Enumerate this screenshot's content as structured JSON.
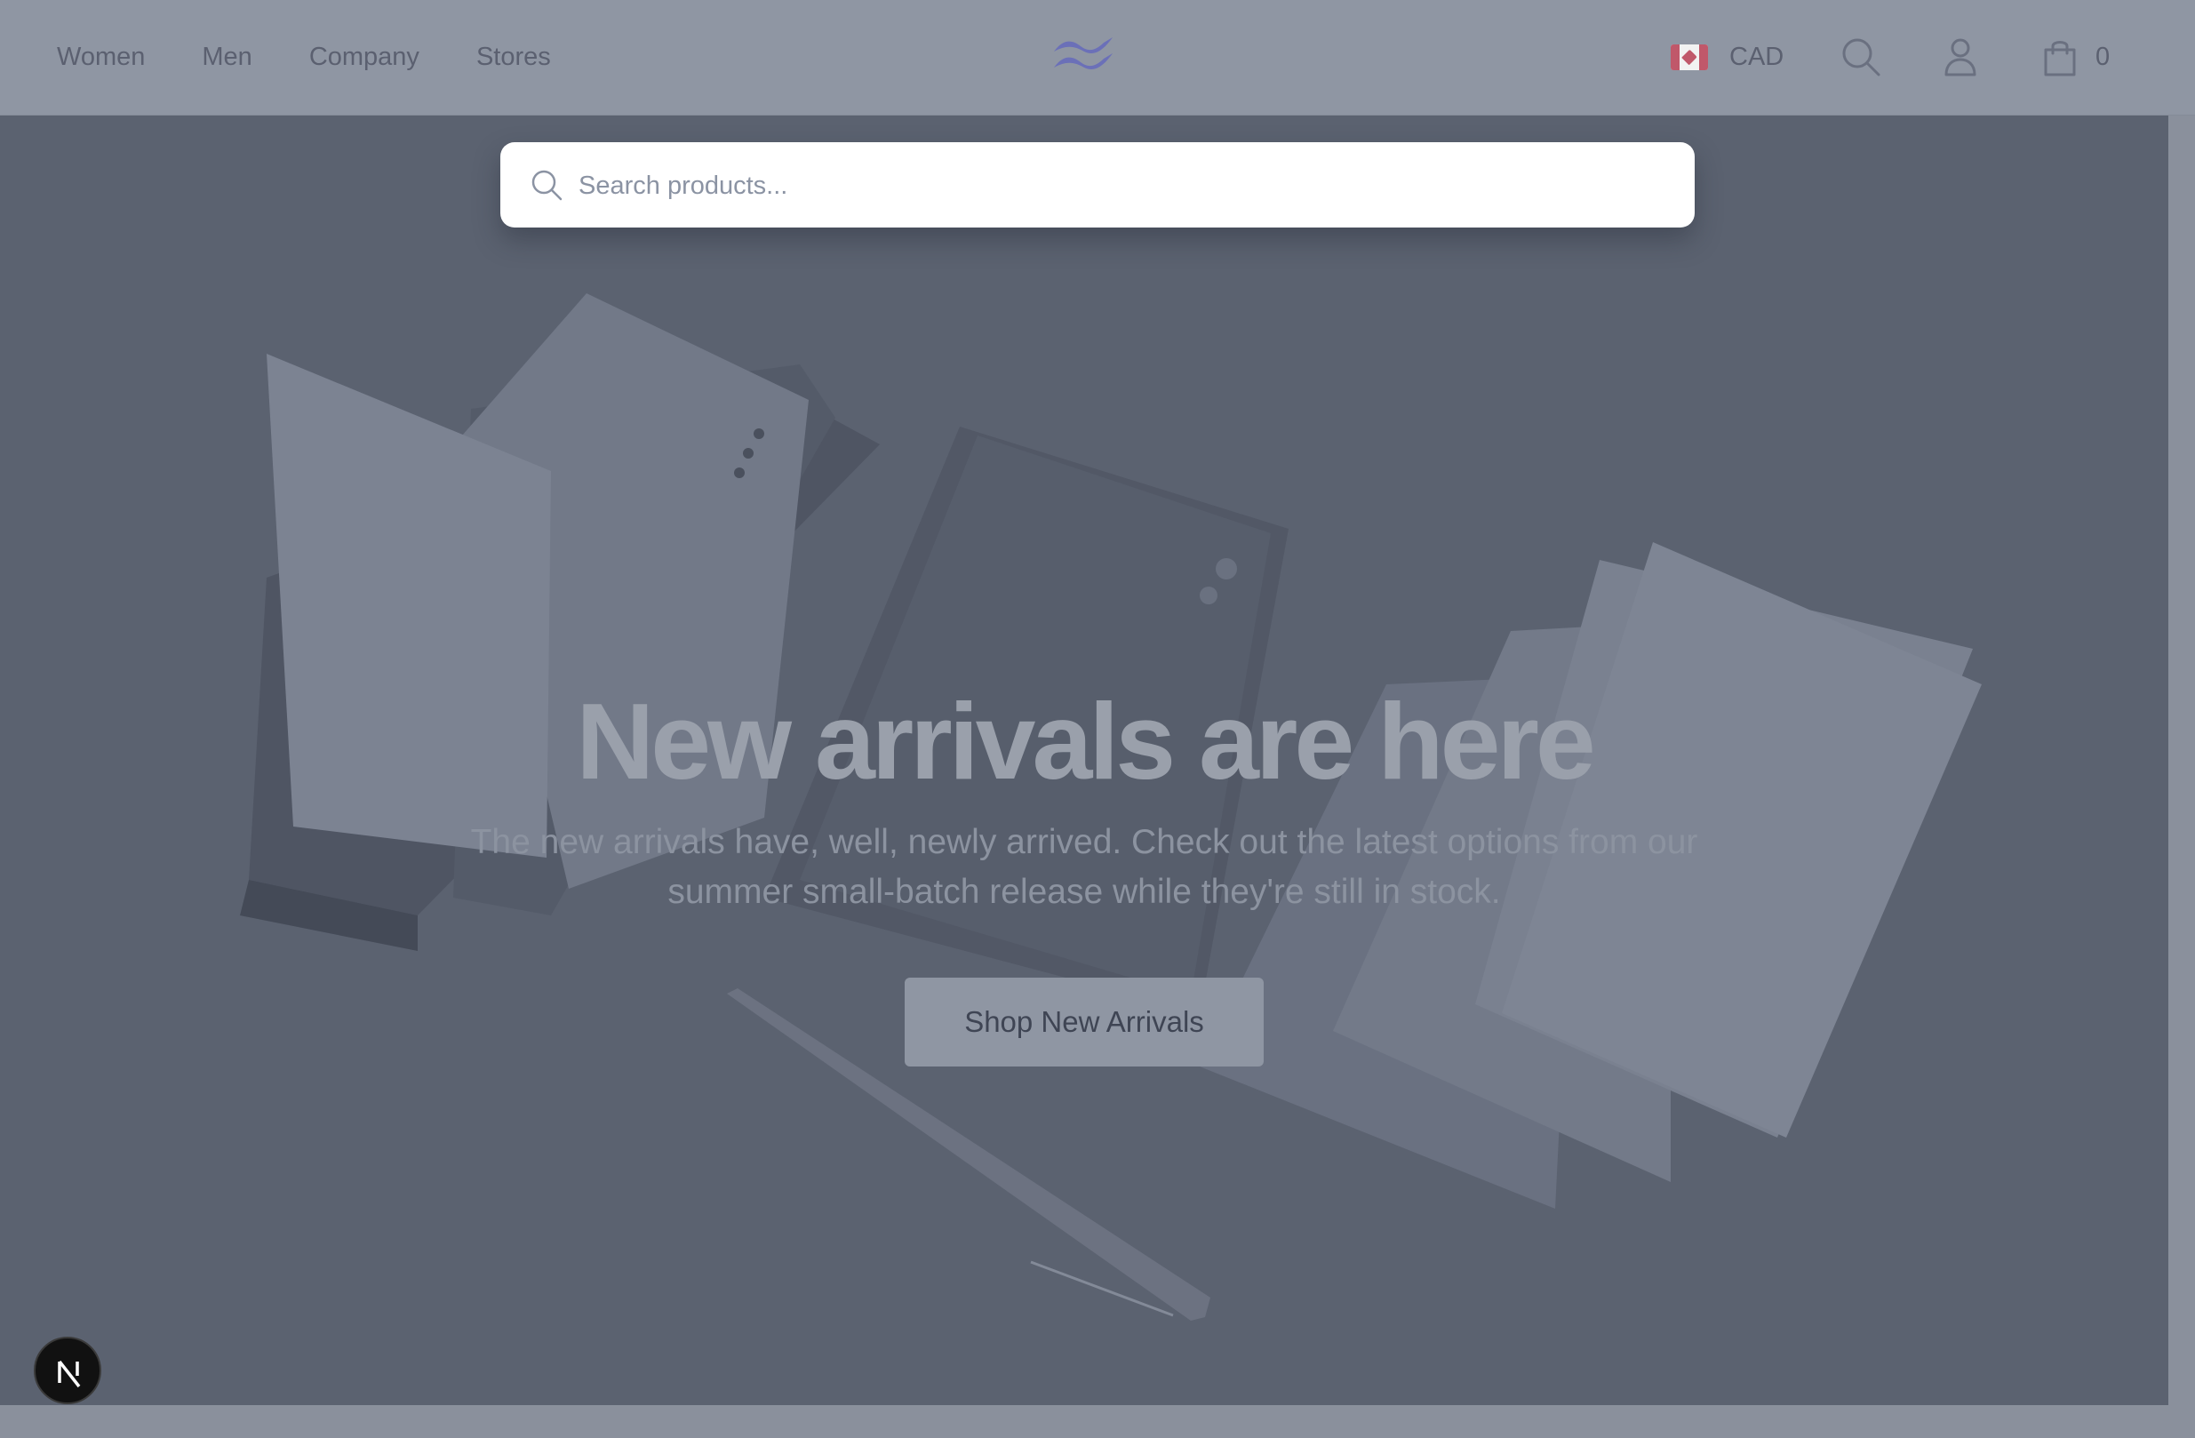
{
  "header": {
    "nav": [
      {
        "label": "Women"
      },
      {
        "label": "Men"
      },
      {
        "label": "Company"
      },
      {
        "label": "Stores"
      }
    ],
    "logo_icon": "tailwind-wave-logo-icon",
    "currency": {
      "code": "CAD",
      "flag_icon": "canada-flag-icon"
    },
    "icons": [
      "search-icon",
      "user-icon",
      "shopping-bag-icon"
    ],
    "cart_count": "0"
  },
  "search": {
    "placeholder": "Search products...",
    "value": ""
  },
  "hero": {
    "title": "New arrivals are here",
    "subtitle": "The new arrivals have, well, newly arrived. Check out the latest options from our summer small-batch release while they're still in stock.",
    "cta_label": "Shop New Arrivals"
  },
  "badge": {
    "label": "N",
    "icon": "nextjs-logo-icon"
  },
  "colors": {
    "header_bg": "#8f96a3",
    "hero_overlay": "#5b6270",
    "logo_accent": "#6b70b8",
    "text_muted": "#5b6070"
  }
}
